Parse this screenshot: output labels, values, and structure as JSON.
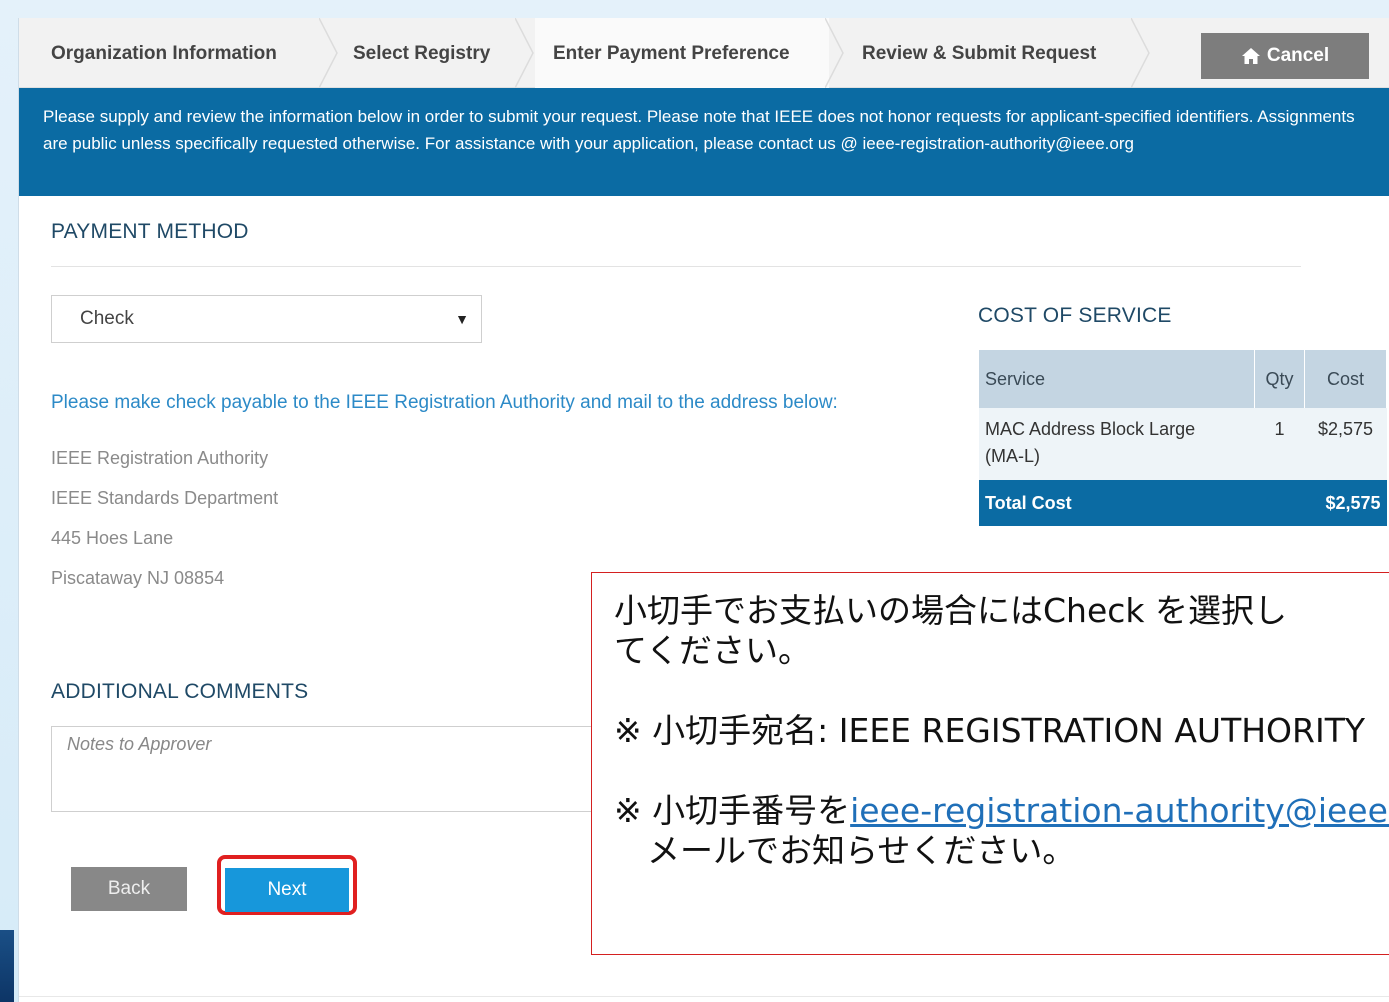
{
  "wizard": {
    "steps": [
      {
        "label": "Organization Information"
      },
      {
        "label": "Select Registry"
      },
      {
        "label": "Enter Payment Preference"
      },
      {
        "label": "Review & Submit Request"
      }
    ],
    "active_step": 2,
    "cancel_label": "Cancel",
    "cancel_icon": "home-icon"
  },
  "banner": {
    "text": "Please supply and review the information below in order to submit your request. Please note that IEEE does not honor requests for applicant-specified identifiers. Assignments are public unless specifically requested otherwise. For assistance with your application, please contact us @ ieee-registration-authority@ieee.org"
  },
  "payment": {
    "heading": "PAYMENT METHOD",
    "selected": "Check",
    "instruction": "Please make check payable to the IEEE Registration Authority and mail to the address below:",
    "address": [
      "IEEE Registration Authority",
      "IEEE Standards Department",
      "445 Hoes Lane",
      "Piscataway NJ 08854"
    ]
  },
  "cost": {
    "heading": "COST OF SERVICE",
    "headers": {
      "service": "Service",
      "qty": "Qty",
      "cost": "Cost"
    },
    "rows": [
      {
        "service_line1": "MAC Address Block Large",
        "service_line2": "(MA-L)",
        "qty": "1",
        "cost": "$2,575"
      }
    ],
    "total_label": "Total Cost",
    "total_value": "$2,575"
  },
  "comments": {
    "heading": "ADDITIONAL COMMENTS",
    "placeholder": "Notes to Approver"
  },
  "buttons": {
    "back": "Back",
    "next": "Next"
  },
  "callout": {
    "line1": "小切手でお支払いの場合にはCheck を選択し",
    "line2": "てください。",
    "line3": "※ 小切手宛名:  IEEE REGISTRATION AUTHORITY",
    "line4_prefix": "※ 小切手番号を",
    "line4_link": "ieee-registration-authority@ieee.org",
    "line5": "　メールでお知らせください。"
  },
  "colors": {
    "banner": "#0b6ba3",
    "next": "#1797db",
    "highlight": "#e02020"
  }
}
